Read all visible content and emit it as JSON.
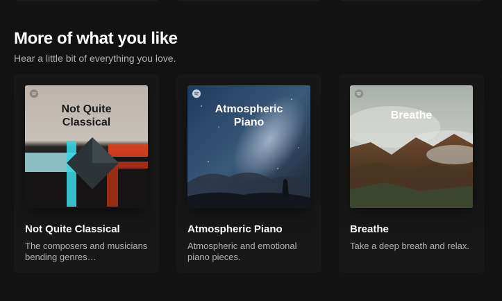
{
  "section": {
    "title": "More of what you like",
    "subtitle": "Hear a little bit of everything you love."
  },
  "cards": [
    {
      "title": "Not Quite Classical",
      "description": "The composers and musicians bending genres…",
      "cover_text": "Not Quite\nClassical",
      "icon": "spotify-logo-icon"
    },
    {
      "title": "Atmospheric Piano",
      "description": "Atmospheric and emotional piano pieces.",
      "cover_text": "Atmospheric\nPiano",
      "icon": "spotify-logo-icon"
    },
    {
      "title": "Breathe",
      "description": "Take a deep breath and relax.",
      "cover_text": "Breathe",
      "icon": "spotify-logo-icon"
    }
  ],
  "colors": {
    "background": "#121212",
    "card": "#181818",
    "subtext": "#b3b3b3"
  }
}
